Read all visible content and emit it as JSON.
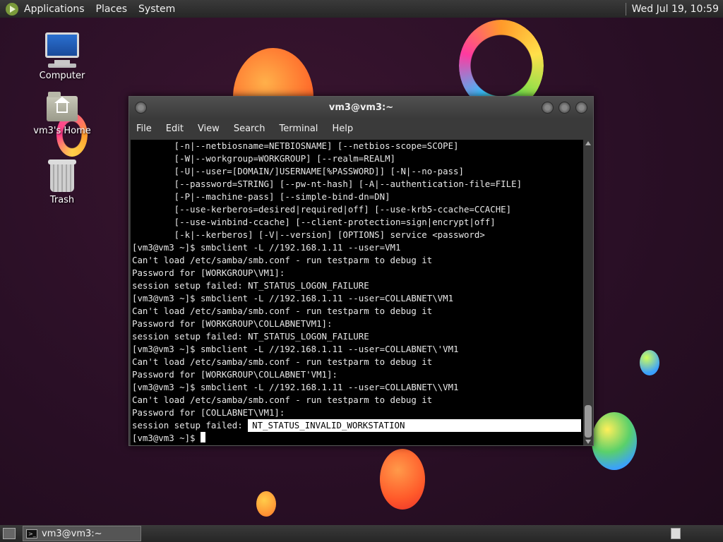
{
  "top_panel": {
    "menus": [
      "Applications",
      "Places",
      "System"
    ],
    "clock": "Wed Jul 19, 10:59"
  },
  "desktop": {
    "icons": [
      {
        "label": "Computer",
        "icon": "computer-icon"
      },
      {
        "label": "vm3's Home",
        "icon": "home-folder-icon"
      },
      {
        "label": "Trash",
        "icon": "trash-icon"
      }
    ]
  },
  "window": {
    "title": "vm3@vm3:~",
    "menus": [
      "File",
      "Edit",
      "View",
      "Search",
      "Terminal",
      "Help"
    ]
  },
  "terminal": {
    "lines": [
      "        [-n|--netbiosname=NETBIOSNAME] [--netbios-scope=SCOPE]",
      "        [-W|--workgroup=WORKGROUP] [--realm=REALM]",
      "        [-U|--user=[DOMAIN/]USERNAME[%PASSWORD]] [-N|--no-pass]",
      "        [--password=STRING] [--pw-nt-hash] [-A|--authentication-file=FILE]",
      "        [-P|--machine-pass] [--simple-bind-dn=DN]",
      "        [--use-kerberos=desired|required|off] [--use-krb5-ccache=CCACHE]",
      "        [--use-winbind-ccache] [--client-protection=sign|encrypt|off]",
      "        [-k|--kerberos] [-V|--version] [OPTIONS] service <password>",
      "[vm3@vm3 ~]$ smbclient -L //192.168.1.11 --user=VM1",
      "Can't load /etc/samba/smb.conf - run testparm to debug it",
      "Password for [WORKGROUP\\VM1]:",
      "session setup failed: NT_STATUS_LOGON_FAILURE",
      "[vm3@vm3 ~]$ smbclient -L //192.168.1.11 --user=COLLABNET\\VM1",
      "Can't load /etc/samba/smb.conf - run testparm to debug it",
      "Password for [WORKGROUP\\COLLABNETVM1]:",
      "session setup failed: NT_STATUS_LOGON_FAILURE",
      "[vm3@vm3 ~]$ smbclient -L //192.168.1.11 --user=COLLABNET\\'VM1",
      "Can't load /etc/samba/smb.conf - run testparm to debug it",
      "Password for [WORKGROUP\\COLLABNET'VM1]:",
      "[vm3@vm3 ~]$ smbclient -L //192.168.1.11 --user=COLLABNET\\\\VM1",
      "Can't load /etc/samba/smb.conf - run testparm to debug it",
      "Password for [COLLABNET\\VM1]:"
    ],
    "last_error_prefix": "session setup failed: ",
    "last_error_highlight": "NT_STATUS_INVALID_WORKSTATION",
    "prompt": "[vm3@vm3 ~]$ "
  },
  "taskbar": {
    "task_label": "vm3@vm3:~"
  }
}
